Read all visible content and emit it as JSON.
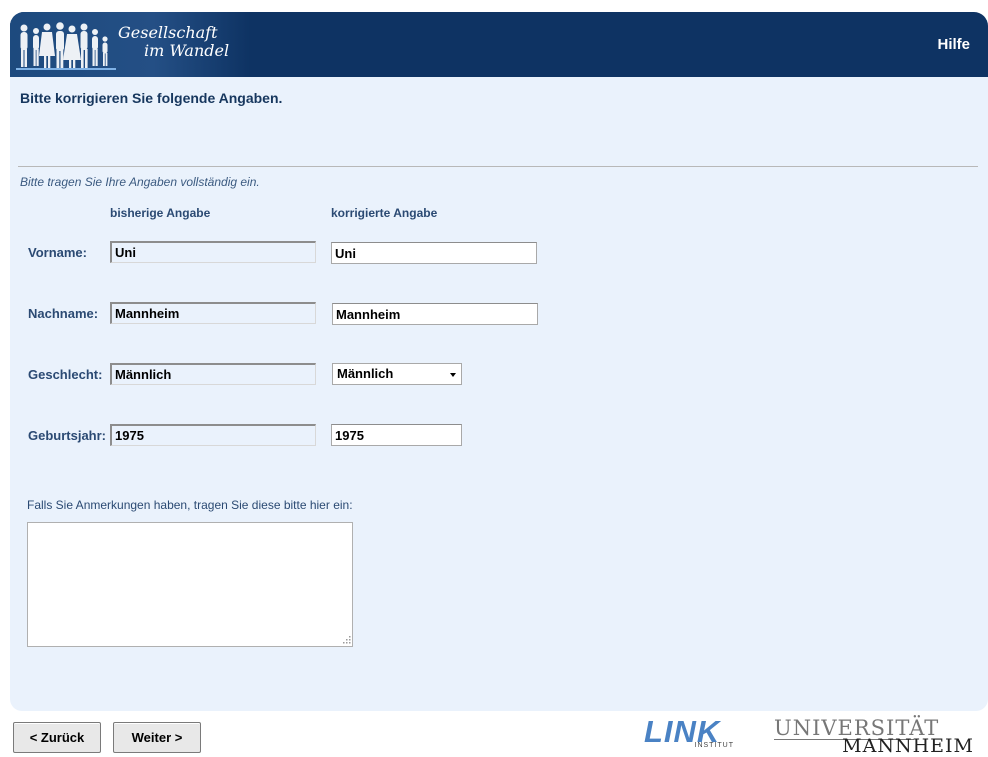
{
  "header": {
    "logo_line1": "Gesellschaft",
    "logo_line2": "im Wandel",
    "help_label": "Hilfe"
  },
  "form": {
    "heading": "Bitte korrigieren Sie folgende Angaben.",
    "instruction": "Bitte tragen Sie Ihre Angaben vollständig ein.",
    "col_previous": "bisherige Angabe",
    "col_corrected": "korrigierte Angabe",
    "rows": [
      {
        "label": "Vorname:",
        "previous": "Uni",
        "corrected": "Uni"
      },
      {
        "label": "Nachname:",
        "previous": "Mannheim",
        "corrected": "Mannheim"
      },
      {
        "label": "Geschlecht:",
        "previous": "Männlich",
        "corrected": "Männlich"
      },
      {
        "label": "Geburtsjahr:",
        "previous": "1975",
        "corrected": "1975"
      }
    ],
    "remarks_label": "Falls Sie Anmerkungen haben, tragen Sie diese bitte hier ein:",
    "remarks_value": ""
  },
  "nav": {
    "back_label": "< Zurück",
    "next_label": "Weiter >"
  },
  "footer": {
    "link_logo": "LINK",
    "link_sub": "INSTITUT",
    "uni_line1": "UNIVERSITÄT",
    "uni_line2": "MANNHEIM"
  },
  "colors": {
    "header_bg": "#0e3363",
    "content_bg": "#eaf2fc",
    "label_text": "#2b4a73"
  }
}
